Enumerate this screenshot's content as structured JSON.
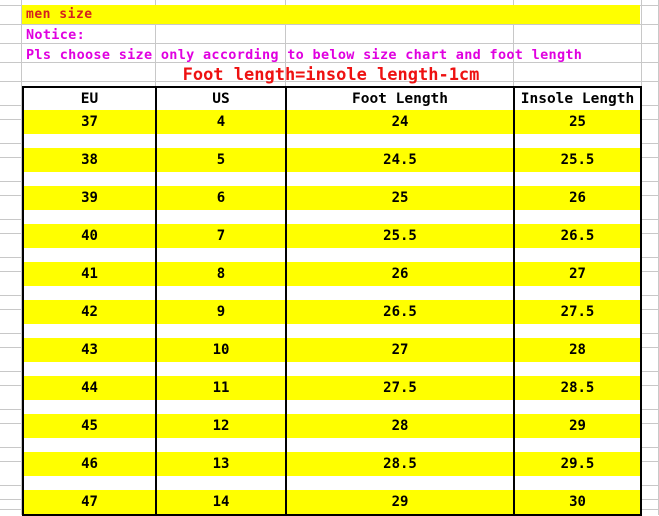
{
  "banner": {
    "label": "men size"
  },
  "notice": {
    "line1": "Notice:",
    "line2": "Pls choose size only according to below size chart and foot length"
  },
  "formula": {
    "text": "Foot length=insole length-1cm"
  },
  "colors": {
    "banner_bg": "#ffff00",
    "banner_text": "#d42020",
    "notice_text": "#e000e0",
    "formula_text": "#ee1111",
    "row_highlight": "#ffff00",
    "row_plain": "#ffffff",
    "border": "#000000",
    "gridline": "#c8c8c8"
  },
  "table": {
    "headers": [
      "EU",
      "US",
      "Foot Length",
      "Insole Length"
    ],
    "rows": [
      [
        "37",
        "4",
        "24",
        "25"
      ],
      [
        "38",
        "5",
        "24.5",
        "25.5"
      ],
      [
        "39",
        "6",
        "25",
        "26"
      ],
      [
        "40",
        "7",
        "25.5",
        "26.5"
      ],
      [
        "41",
        "8",
        "26",
        "27"
      ],
      [
        "42",
        "9",
        "26.5",
        "27.5"
      ],
      [
        "43",
        "10",
        "27",
        "28"
      ],
      [
        "44",
        "11",
        "27.5",
        "28.5"
      ],
      [
        "45",
        "12",
        "28",
        "29"
      ],
      [
        "46",
        "13",
        "28.5",
        "29.5"
      ],
      [
        "47",
        "14",
        "29",
        "30"
      ]
    ]
  }
}
